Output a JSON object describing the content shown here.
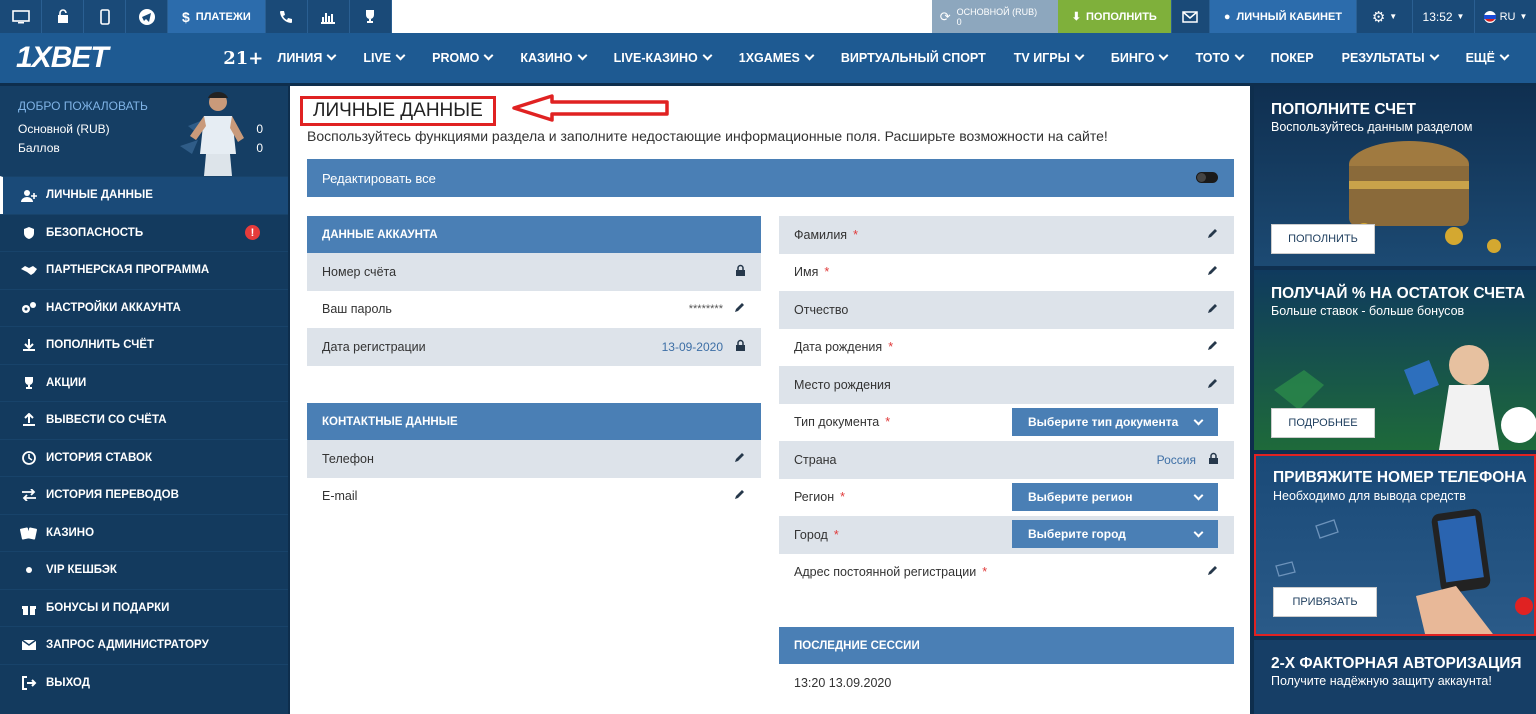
{
  "topbar": {
    "payments": "ПЛАТЕЖИ",
    "balance_label": "ОСНОВНОЙ (RUB)",
    "balance_value": "0",
    "topup": "ПОПОЛНИТЬ",
    "cabinet": "ЛИЧНЫЙ КАБИНЕТ",
    "time": "13:52",
    "lang": "RU"
  },
  "nav": {
    "logo": "1XBET",
    "age": "21+",
    "items": [
      {
        "label": "ЛИНИЯ",
        "chev": true
      },
      {
        "label": "LIVE",
        "chev": true
      },
      {
        "label": "PROMO",
        "chev": true
      },
      {
        "label": "КАЗИНО",
        "chev": true
      },
      {
        "label": "LIVE-КАЗИНО",
        "chev": true
      },
      {
        "label": "1XGAMES",
        "chev": true
      },
      {
        "label": "ВИРТУАЛЬНЫЙ СПОРТ",
        "chev": false
      },
      {
        "label": "TV ИГРЫ",
        "chev": true
      },
      {
        "label": "БИНГО",
        "chev": true
      },
      {
        "label": "ТОТО",
        "chev": true
      },
      {
        "label": "ПОКЕР",
        "chev": false
      },
      {
        "label": "РЕЗУЛЬТАТЫ",
        "chev": true
      },
      {
        "label": "ЕЩЁ",
        "chev": true
      }
    ]
  },
  "sidebar": {
    "welcome": "ДОБРО ПОЖАЛОВАТЬ",
    "main_label": "Основной (RUB)",
    "main_value": "0",
    "points_label": "Баллов",
    "points_value": "0",
    "items": [
      {
        "label": "ЛИЧНЫЕ ДАННЫЕ",
        "icon": "user-icon"
      },
      {
        "label": "БЕЗОПАСНОСТЬ",
        "icon": "shield-icon"
      },
      {
        "label": "ПАРТНЕРСКАЯ ПРОГРАММА",
        "icon": "handshake-icon"
      },
      {
        "label": "НАСТРОЙКИ АККАУНТА",
        "icon": "gears-icon"
      },
      {
        "label": "ПОПОЛНИТЬ СЧЁТ",
        "icon": "download-icon"
      },
      {
        "label": "АКЦИИ",
        "icon": "trophy-icon"
      },
      {
        "label": "ВЫВЕСТИ СО СЧЁТА",
        "icon": "upload-icon"
      },
      {
        "label": "ИСТОРИЯ СТАВОК",
        "icon": "clock-icon"
      },
      {
        "label": "ИСТОРИЯ ПЕРЕВОДОВ",
        "icon": "transfer-icon"
      },
      {
        "label": "КАЗИНО",
        "icon": "cards-icon"
      },
      {
        "label": "VIP КЕШБЭК",
        "icon": "dot-icon"
      },
      {
        "label": "БОНУСЫ И ПОДАРКИ",
        "icon": "gift-icon"
      },
      {
        "label": "ЗАПРОС АДМИНИСТРАТОРУ",
        "icon": "mail-icon"
      },
      {
        "label": "ВЫХОД",
        "icon": "exit-icon"
      }
    ],
    "security_alert": "!"
  },
  "main": {
    "title": "ЛИЧНЫЕ ДАННЫЕ",
    "subtitle": "Воспользуйтесь функциями раздела и заполните недостающие информационные поля. Расширьте возможности на сайте!",
    "edit_all": "Редактировать все",
    "account": {
      "header": "ДАННЫЕ АККАУНТА",
      "number": "Номер счёта",
      "password": "Ваш пароль",
      "password_value": "********",
      "reg_date": "Дата регистрации",
      "reg_date_value": "13-09-2020"
    },
    "contacts": {
      "header": "КОНТАКТНЫЕ ДАННЫЕ",
      "phone": "Телефон",
      "email": "E-mail"
    },
    "personal": {
      "surname": "Фамилия",
      "name": "Имя",
      "patronymic": "Отчество",
      "birth_date": "Дата рождения",
      "birth_place": "Место рождения",
      "doc_type": "Тип документа",
      "doc_type_select": "Выберите тип документа",
      "country": "Страна",
      "country_value": "Россия",
      "region": "Регион",
      "region_select": "Выберите регион",
      "city": "Город",
      "city_select": "Выберите город",
      "address": "Адрес постоянной регистрации"
    },
    "sessions": {
      "header": "ПОСЛЕДНИЕ СЕССИИ",
      "first": "13:20 13.09.2020"
    }
  },
  "promos": [
    {
      "title": "ПОПОЛНИТЕ СЧЕТ",
      "sub": "Воспользуйтесь данным разделом",
      "btn": "ПОПОЛНИТЬ"
    },
    {
      "title": "ПОЛУЧАЙ % НА ОСТАТОК СЧЕТА",
      "sub": "Больше ставок - больше бонусов",
      "btn": "ПОДРОБНЕЕ"
    },
    {
      "title": "ПРИВЯЖИТЕ НОМЕР ТЕЛЕФОНА",
      "sub": "Необходимо для вывода средств",
      "btn": "ПРИВЯЗАТЬ"
    },
    {
      "title": "2-Х ФАКТОРНАЯ АВТОРИЗАЦИЯ",
      "sub": "Получите надёжную защиту аккаунта!"
    }
  ],
  "colors": {
    "primary": "#1e5a92",
    "section": "#4a7fb5",
    "topup": "#7fb03b",
    "alert": "#e02222"
  }
}
